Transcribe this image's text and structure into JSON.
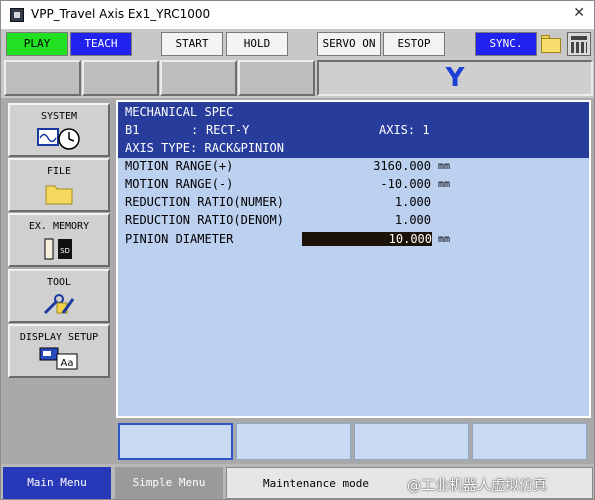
{
  "window": {
    "title": "VPP_Travel Axis Ex1_YRC1000",
    "close_glyph": "✕"
  },
  "toolbar": {
    "play": "PLAY",
    "teach": "TEACH",
    "start": "START",
    "hold": "HOLD",
    "servo_on": "SERVO ON",
    "estop": "ESTOP",
    "sync": "SYNC."
  },
  "axis_display": {
    "letter": "Y"
  },
  "menu": {
    "system": "SYSTEM",
    "file": "FILE",
    "ex_memory": "EX. MEMORY",
    "tool": "TOOL",
    "display_setup": "DISPLAY SETUP",
    "sd_label": "SD",
    "aa_label": "Aa"
  },
  "spec": {
    "title": "MECHANICAL SPEC",
    "group": "B1",
    "group_sep": ":",
    "axis_type_name": "RECT-Y",
    "axis_label": "AXIS: 1",
    "axis_type_line": "AXIS TYPE: RACK&PINION",
    "rows": [
      {
        "label": "MOTION RANGE(+)",
        "value": "3160.000",
        "unit": "mm"
      },
      {
        "label": "MOTION RANGE(-)",
        "value": "-10.000",
        "unit": "mm"
      },
      {
        "label": "REDUCTION RATIO(NUMER)",
        "value": "1.000",
        "unit": ""
      },
      {
        "label": "REDUCTION RATIO(DENOM)",
        "value": "1.000",
        "unit": ""
      },
      {
        "label": "PINION DIAMETER",
        "value": "10.000",
        "unit": "mm"
      }
    ]
  },
  "status": {
    "main_menu": "Main Menu",
    "simple_menu": "Simple Menu",
    "mode": "Maintenance mode",
    "watermark": "@工业机器人虚拟仿真"
  },
  "colors": {
    "header_blue": "#283c9c",
    "panel_light_blue": "#bcd0ef",
    "play_green": "#22e022",
    "teach_blue": "#2222ee",
    "axis_letter_blue": "#1c3fd6"
  }
}
